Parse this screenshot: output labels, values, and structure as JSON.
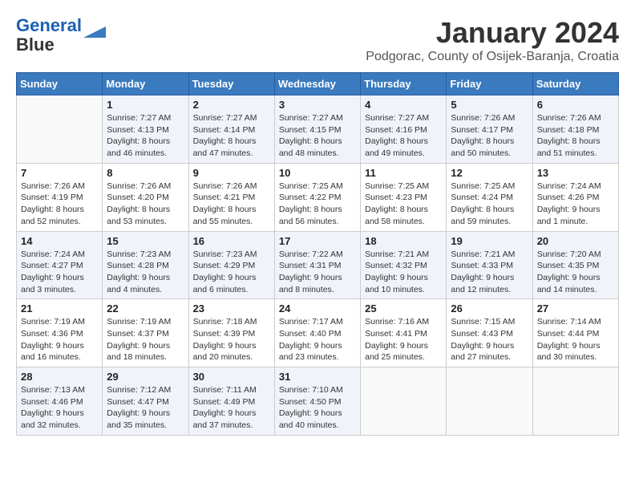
{
  "header": {
    "logo_line1": "General",
    "logo_line2": "Blue",
    "title": "January 2024",
    "subtitle": "Podgorac, County of Osijek-Baranja, Croatia"
  },
  "days_of_week": [
    "Sunday",
    "Monday",
    "Tuesday",
    "Wednesday",
    "Thursday",
    "Friday",
    "Saturday"
  ],
  "weeks": [
    [
      {
        "day": "",
        "info": ""
      },
      {
        "day": "1",
        "info": "Sunrise: 7:27 AM\nSunset: 4:13 PM\nDaylight: 8 hours\nand 46 minutes."
      },
      {
        "day": "2",
        "info": "Sunrise: 7:27 AM\nSunset: 4:14 PM\nDaylight: 8 hours\nand 47 minutes."
      },
      {
        "day": "3",
        "info": "Sunrise: 7:27 AM\nSunset: 4:15 PM\nDaylight: 8 hours\nand 48 minutes."
      },
      {
        "day": "4",
        "info": "Sunrise: 7:27 AM\nSunset: 4:16 PM\nDaylight: 8 hours\nand 49 minutes."
      },
      {
        "day": "5",
        "info": "Sunrise: 7:26 AM\nSunset: 4:17 PM\nDaylight: 8 hours\nand 50 minutes."
      },
      {
        "day": "6",
        "info": "Sunrise: 7:26 AM\nSunset: 4:18 PM\nDaylight: 8 hours\nand 51 minutes."
      }
    ],
    [
      {
        "day": "7",
        "info": "Sunrise: 7:26 AM\nSunset: 4:19 PM\nDaylight: 8 hours\nand 52 minutes."
      },
      {
        "day": "8",
        "info": "Sunrise: 7:26 AM\nSunset: 4:20 PM\nDaylight: 8 hours\nand 53 minutes."
      },
      {
        "day": "9",
        "info": "Sunrise: 7:26 AM\nSunset: 4:21 PM\nDaylight: 8 hours\nand 55 minutes."
      },
      {
        "day": "10",
        "info": "Sunrise: 7:25 AM\nSunset: 4:22 PM\nDaylight: 8 hours\nand 56 minutes."
      },
      {
        "day": "11",
        "info": "Sunrise: 7:25 AM\nSunset: 4:23 PM\nDaylight: 8 hours\nand 58 minutes."
      },
      {
        "day": "12",
        "info": "Sunrise: 7:25 AM\nSunset: 4:24 PM\nDaylight: 8 hours\nand 59 minutes."
      },
      {
        "day": "13",
        "info": "Sunrise: 7:24 AM\nSunset: 4:26 PM\nDaylight: 9 hours\nand 1 minute."
      }
    ],
    [
      {
        "day": "14",
        "info": "Sunrise: 7:24 AM\nSunset: 4:27 PM\nDaylight: 9 hours\nand 3 minutes."
      },
      {
        "day": "15",
        "info": "Sunrise: 7:23 AM\nSunset: 4:28 PM\nDaylight: 9 hours\nand 4 minutes."
      },
      {
        "day": "16",
        "info": "Sunrise: 7:23 AM\nSunset: 4:29 PM\nDaylight: 9 hours\nand 6 minutes."
      },
      {
        "day": "17",
        "info": "Sunrise: 7:22 AM\nSunset: 4:31 PM\nDaylight: 9 hours\nand 8 minutes."
      },
      {
        "day": "18",
        "info": "Sunrise: 7:21 AM\nSunset: 4:32 PM\nDaylight: 9 hours\nand 10 minutes."
      },
      {
        "day": "19",
        "info": "Sunrise: 7:21 AM\nSunset: 4:33 PM\nDaylight: 9 hours\nand 12 minutes."
      },
      {
        "day": "20",
        "info": "Sunrise: 7:20 AM\nSunset: 4:35 PM\nDaylight: 9 hours\nand 14 minutes."
      }
    ],
    [
      {
        "day": "21",
        "info": "Sunrise: 7:19 AM\nSunset: 4:36 PM\nDaylight: 9 hours\nand 16 minutes."
      },
      {
        "day": "22",
        "info": "Sunrise: 7:19 AM\nSunset: 4:37 PM\nDaylight: 9 hours\nand 18 minutes."
      },
      {
        "day": "23",
        "info": "Sunrise: 7:18 AM\nSunset: 4:39 PM\nDaylight: 9 hours\nand 20 minutes."
      },
      {
        "day": "24",
        "info": "Sunrise: 7:17 AM\nSunset: 4:40 PM\nDaylight: 9 hours\nand 23 minutes."
      },
      {
        "day": "25",
        "info": "Sunrise: 7:16 AM\nSunset: 4:41 PM\nDaylight: 9 hours\nand 25 minutes."
      },
      {
        "day": "26",
        "info": "Sunrise: 7:15 AM\nSunset: 4:43 PM\nDaylight: 9 hours\nand 27 minutes."
      },
      {
        "day": "27",
        "info": "Sunrise: 7:14 AM\nSunset: 4:44 PM\nDaylight: 9 hours\nand 30 minutes."
      }
    ],
    [
      {
        "day": "28",
        "info": "Sunrise: 7:13 AM\nSunset: 4:46 PM\nDaylight: 9 hours\nand 32 minutes."
      },
      {
        "day": "29",
        "info": "Sunrise: 7:12 AM\nSunset: 4:47 PM\nDaylight: 9 hours\nand 35 minutes."
      },
      {
        "day": "30",
        "info": "Sunrise: 7:11 AM\nSunset: 4:49 PM\nDaylight: 9 hours\nand 37 minutes."
      },
      {
        "day": "31",
        "info": "Sunrise: 7:10 AM\nSunset: 4:50 PM\nDaylight: 9 hours\nand 40 minutes."
      },
      {
        "day": "",
        "info": ""
      },
      {
        "day": "",
        "info": ""
      },
      {
        "day": "",
        "info": ""
      }
    ]
  ]
}
